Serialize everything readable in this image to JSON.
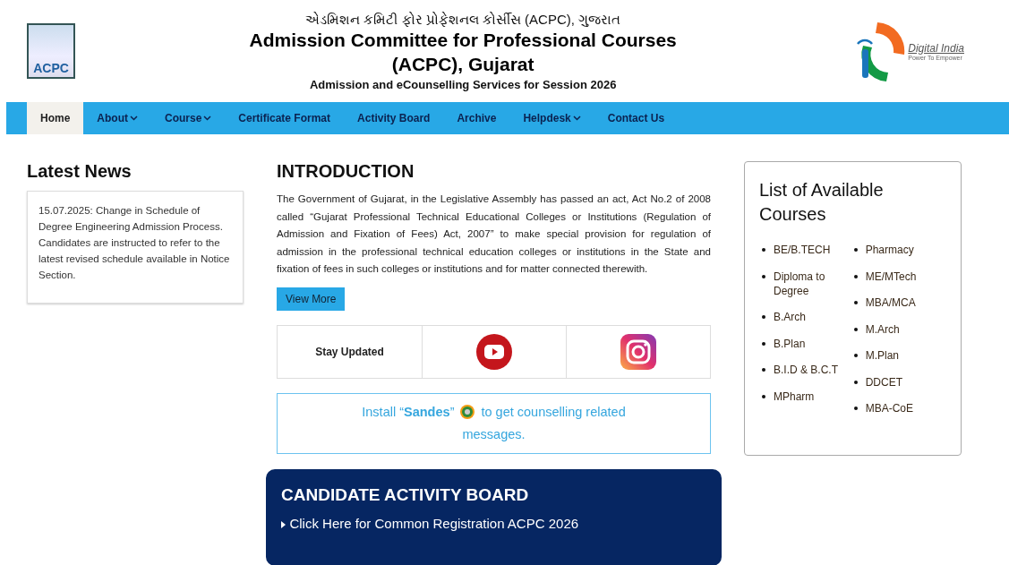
{
  "header": {
    "logo_text": "ACPC",
    "title_gujarati": "એડમિશન કમિટી ફોર પ્રોફેશનલ કોર્સીસ (ACPC), ગુજરાત",
    "title": "Admission Committee for Professional Courses (ACPC), Gujarat",
    "subtitle": "Admission and eCounselling Services for Session 2026",
    "partner_logo": {
      "name": "Digital India",
      "tagline": "Power To Empower"
    }
  },
  "nav": [
    {
      "label": "Home",
      "selected": true,
      "dropdown": false
    },
    {
      "label": "About",
      "selected": false,
      "dropdown": true
    },
    {
      "label": "Course",
      "selected": false,
      "dropdown": true
    },
    {
      "label": "Certificate Format",
      "selected": false,
      "dropdown": false
    },
    {
      "label": "Activity Board",
      "selected": false,
      "dropdown": false
    },
    {
      "label": "Archive",
      "selected": false,
      "dropdown": false
    },
    {
      "label": "Helpdesk",
      "selected": false,
      "dropdown": true
    },
    {
      "label": "Contact Us",
      "selected": false,
      "dropdown": false
    }
  ],
  "latest_news": {
    "title": "Latest News",
    "items": [
      "15.07.2025: Change in Schedule of Degree Engineering Admission Process. Candidates are instructed to refer to the latest revised schedule available in Notice Section."
    ]
  },
  "introduction": {
    "title": "INTRODUCTION",
    "text": "The Government of Gujarat, in the Legislative Assembly has passed an act, Act No.2 of 2008 called “Gujarat Professional Technical Educational Colleges or Institutions (Regulation of Admission and Fixation of Fees) Act, 2007” to make special provision for regulation of admission in the professional technical education colleges or institutions in the State and fixation of fees in such colleges or institutions and for matter connected therewith.",
    "button": "View More"
  },
  "stay_updated": {
    "label": "Stay Updated",
    "links": [
      {
        "kind": "youtube"
      },
      {
        "kind": "instagram"
      }
    ]
  },
  "sandes": {
    "before": "Install “**Sandes**”",
    "after": [
      "to get counselling related",
      "messages."
    ]
  },
  "activity_board": {
    "title": "CANDIDATE ACTIVITY BOARD",
    "links": [
      "Click Here for Common Registration ACPC 2026"
    ]
  },
  "courses": {
    "title": "List of Available Courses",
    "columns": [
      [
        "BE/B.TECH",
        "Diploma to Degree",
        "B.Arch",
        "B.Plan",
        "B.I.D & B.C.T",
        "MPharm"
      ],
      [
        "Pharmacy",
        "ME/MTech",
        "MBA/MCA",
        "M.Arch",
        "M.Plan",
        "DDCET",
        "MBA-CoE"
      ]
    ]
  }
}
